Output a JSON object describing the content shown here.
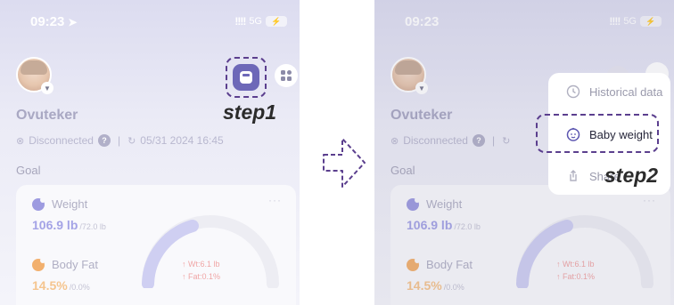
{
  "colors": {
    "accent": "#6d68b8",
    "highlight": "#5b3f8e",
    "weight": "#9d9be0",
    "fat": "#f2b06e"
  },
  "screens": [
    {
      "status": {
        "time": "09:23",
        "location_glyph": "➤",
        "signal": "!!!!",
        "network": "5G",
        "battery_glyph": "⚡"
      },
      "app_name": "Ovuteker",
      "connection": {
        "status_icon": "⊗",
        "status": "Disconnected",
        "help": "?",
        "sync_icon": "↻",
        "last_sync": "05/31 2024 16:45"
      },
      "goal_title": "Goal",
      "card": {
        "more": "···",
        "weight": {
          "label": "Weight",
          "value": "106.9 lb",
          "target": "/72.0 lb"
        },
        "body_fat": {
          "label": "Body Fat",
          "value": "14.5%",
          "target": "/0.0%"
        },
        "gauge": {
          "wt": "↑ Wt:6.1 lb",
          "fat": "↑ Fat:0.1%"
        }
      },
      "step_label": "step1"
    },
    {
      "status": {
        "time": "09:23",
        "signal": "!!!!",
        "network": "5G",
        "battery_glyph": "⚡"
      },
      "app_name": "Ovuteker",
      "connection": {
        "status_icon": "⊗",
        "status": "Disconnected",
        "help": "?",
        "sync_icon": "↻"
      },
      "goal_title": "Goal",
      "card": {
        "more": "···",
        "weight": {
          "label": "Weight",
          "value": "106.9 lb",
          "target": "/72.0 lb"
        },
        "body_fat": {
          "label": "Body Fat",
          "value": "14.5%",
          "target": "/0.0%"
        },
        "gauge": {
          "wt": "↑ Wt:6.1 lb",
          "fat": "↑ Fat:0.1%"
        }
      },
      "menu": {
        "items": [
          {
            "icon": "clock-icon",
            "label": "Historical data"
          },
          {
            "icon": "baby-face-icon",
            "label": "Baby weight"
          },
          {
            "icon": "share-icon",
            "label": "Share"
          }
        ]
      },
      "step_label": "step2"
    }
  ]
}
